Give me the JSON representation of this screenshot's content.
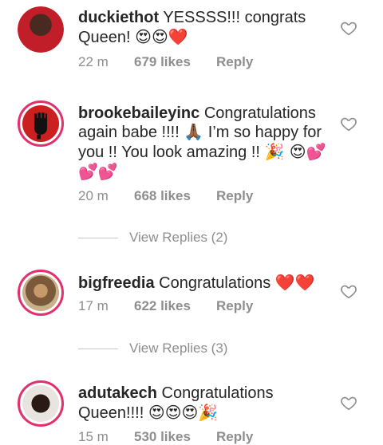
{
  "comments": [
    {
      "username": "duckiethot",
      "text": "YESSSS!!! congrats Queen!",
      "emoji": "😍😍❤️",
      "time": "22 m",
      "likes": "679 likes",
      "reply": "Reply"
    },
    {
      "username": "brookebaileyinc",
      "text": "Congratulations again babe !!!! 🙏🏾 I’m so happy for you !! You look amazing !!",
      "emoji": "🎉 😍💕💕💕",
      "time": "20 m",
      "likes": "668 likes",
      "reply": "Reply",
      "view_replies": "View Replies (2)"
    },
    {
      "username": "bigfreedia",
      "text": "Congratulations",
      "emoji": "❤️❤️",
      "time": "17 m",
      "likes": "622 likes",
      "reply": "Reply",
      "view_replies": "View Replies (3)"
    },
    {
      "username": "adutakech",
      "text": "Congratulations Queen!!!!",
      "emoji": "😍😍😍🎉",
      "time": "15 m",
      "likes": "530 likes",
      "reply": "Reply"
    }
  ],
  "colors": {
    "story_ring": "#e1306c",
    "meta": "#8e8e8e",
    "text": "#262626"
  }
}
